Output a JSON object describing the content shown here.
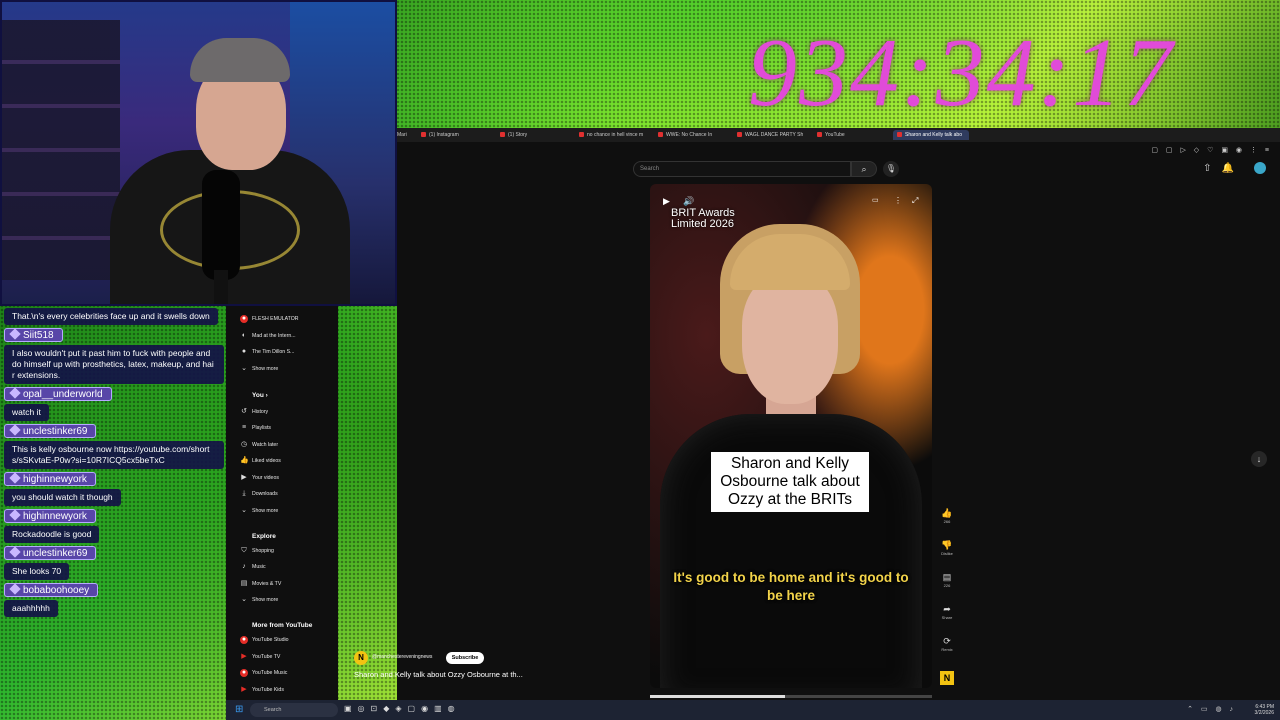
{
  "overlay": {
    "timer": "934:34:17"
  },
  "chat": [
    {
      "user": "",
      "message": "That.\\n's every celebrities face up and it swells down"
    },
    {
      "user": "Siit518",
      "message": "I also wouldn't put it past him to fuck with people and do himself up with prosthetics, latex, makeup, and hair extensions."
    },
    {
      "user": "opal__underworld",
      "message": "watch it"
    },
    {
      "user": "unclestinker69",
      "message": "This is kelly osbourne now https://youtube.com/shorts/sSKvtaE-P0w?si=10R7ICQ5cx5beTxC"
    },
    {
      "user": "highinnewyork",
      "message": "you should watch it though"
    },
    {
      "user": "highinnewyork",
      "message": "Rockadoodle is good"
    },
    {
      "user": "unclestinker69",
      "message": "She looks 70"
    },
    {
      "user": "bobaboohooey",
      "message": "aaahhhhh"
    }
  ],
  "browser": {
    "tabs": [
      "Mari",
      "(1) Instagram",
      "(1) Story",
      "no chance in hell vince m",
      "WWE: No Chance In",
      "WAGL DANCE PARTY Sh",
      "YouTube",
      "Sharon and Kelly talk abo"
    ],
    "active_tab_index": 7
  },
  "youtube": {
    "search_placeholder": "Search",
    "subscriptions": [
      {
        "label": "FLESH EMULATOR"
      },
      {
        "label": "Mad at the Intern..."
      },
      {
        "label": "The Tim Dillon S..."
      }
    ],
    "subs_show_more": "Show more",
    "you_heading": "You",
    "you_items": [
      "History",
      "Playlists",
      "Watch later",
      "Liked videos",
      "Your videos",
      "Downloads",
      "Show more"
    ],
    "explore_heading": "Explore",
    "explore_items": [
      "Shopping",
      "Music",
      "Movies & TV",
      "Show more"
    ],
    "more_heading": "More from YouTube",
    "more_items": [
      "YouTube Studio",
      "YouTube TV",
      "YouTube Music",
      "YouTube Kids"
    ],
    "video": {
      "overlay_title_line1": "BRIT Awards",
      "overlay_title_line2": "Limited 2026",
      "caption_box": "Sharon and Kelly Osbourne talk about Ozzy at the BRITs",
      "subtitle": "It's good to be home and it's good to be here",
      "progress": 0.48
    },
    "actions": [
      {
        "icon": "like-icon",
        "label": "266"
      },
      {
        "icon": "dislike-icon",
        "label": "Dislike"
      },
      {
        "icon": "comment-icon",
        "label": "226"
      },
      {
        "icon": "share-icon",
        "label": "Share"
      },
      {
        "icon": "remix-icon",
        "label": "Remix"
      }
    ],
    "channel": {
      "name": "@manchestereveningnews",
      "avatar_letter": "N",
      "subscribe_label": "Subscribe",
      "title": "Sharon and Kelly talk about Ozzy Osbourne at th..."
    }
  },
  "taskbar": {
    "search_placeholder": "Search",
    "time": "6:43 PM",
    "date": "3/2/2026"
  }
}
